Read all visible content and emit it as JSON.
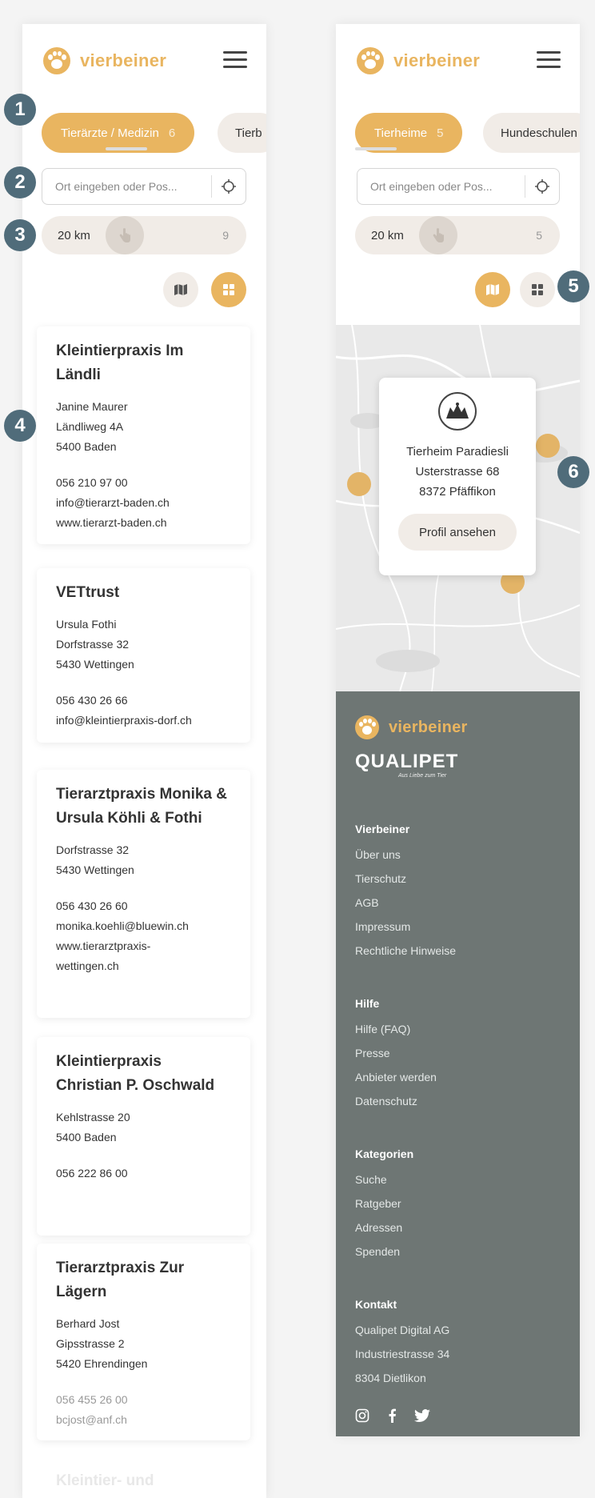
{
  "brand": {
    "name": "vierbeiner",
    "color": "#e9b560"
  },
  "left": {
    "active_tab": {
      "label": "Tierärzte / Medizin",
      "count": "6"
    },
    "next_tab": {
      "label": "Tierb"
    },
    "search": {
      "placeholder": "Ort eingeben oder Pos..."
    },
    "range": {
      "value": "20 km",
      "max": "9"
    },
    "view_toggle": {
      "map_icon": "map-icon",
      "grid_icon": "grid-icon",
      "active": "grid"
    },
    "cards": [
      {
        "title": "Kleintierpraxis Im Ländli",
        "lines": [
          "Janine Maurer",
          "Ländliweg 4A",
          "5400 Baden"
        ],
        "contact": [
          "056 210 97 00",
          "info@tierarzt-baden.ch",
          "www.tierarzt-baden.ch"
        ]
      },
      {
        "title": "VETtrust",
        "lines": [
          "Ursula Fothi",
          "Dorfstrasse 32",
          "5430 Wettingen"
        ],
        "contact": [
          "056 430 26 66",
          "info@kleintierpraxis-dorf.ch"
        ]
      },
      {
        "title": "Tierarztpraxis Monika & Ursula Köhli & Fothi",
        "lines": [
          "Dorfstrasse 32",
          "5430 Wettingen"
        ],
        "contact": [
          "056 430 26 60",
          "monika.koehli@bluewin.ch",
          "www.tierarztpraxis-",
          "wettingen.ch"
        ]
      },
      {
        "title": "Kleintierpraxis Christian P. Oschwald",
        "lines": [
          "Kehlstrasse 20",
          "5400 Baden"
        ],
        "contact": [
          "056 222 86 00"
        ]
      },
      {
        "title": "Tierarztpraxis Zur Lägern",
        "lines": [
          "Berhard Jost",
          "Gipsstrasse 2",
          "5420 Ehrendingen"
        ],
        "contact": [
          "056 455 26 00",
          "bcjost@anf.ch"
        ]
      },
      {
        "title": "Kleintier- und",
        "lines": [],
        "contact": []
      }
    ]
  },
  "right": {
    "active_tab": {
      "label": "Tierheime",
      "count": "5"
    },
    "next_tab": {
      "label": "Hundeschulen"
    },
    "search": {
      "placeholder": "Ort eingeben oder Pos..."
    },
    "range": {
      "value": "20 km",
      "max": "5"
    },
    "view_toggle": {
      "map_icon": "map-icon",
      "grid_icon": "grid-icon",
      "active": "map"
    },
    "popup": {
      "name": "Tierheim Paradiesli",
      "street": "Usterstrasse 68",
      "city": "8372 Pfäffikon",
      "button": "Profil ansehen"
    },
    "footer": {
      "brand": "vierbeiner",
      "partner": "QUALIPET",
      "partner_tagline": "Aus Liebe zum Tier",
      "sections": [
        {
          "title": "Vierbeiner",
          "links": [
            "Über uns",
            "Tierschutz",
            "AGB",
            "Impressum",
            "Rechtliche Hinweise"
          ]
        },
        {
          "title": "Hilfe",
          "links": [
            "Hilfe (FAQ)",
            "Presse",
            "Anbieter werden",
            "Datenschutz"
          ]
        },
        {
          "title": "Kategorien",
          "links": [
            "Suche",
            "Ratgeber",
            "Adressen",
            "Spenden"
          ]
        },
        {
          "title": "Kontakt",
          "links": [
            "Qualipet Digital AG",
            "Industriestrasse 34",
            "8304 Dietlikon"
          ]
        }
      ],
      "social": [
        "instagram-icon",
        "facebook-icon",
        "twitter-icon"
      ]
    }
  },
  "annotations": [
    "1",
    "2",
    "3",
    "4",
    "5",
    "6"
  ]
}
